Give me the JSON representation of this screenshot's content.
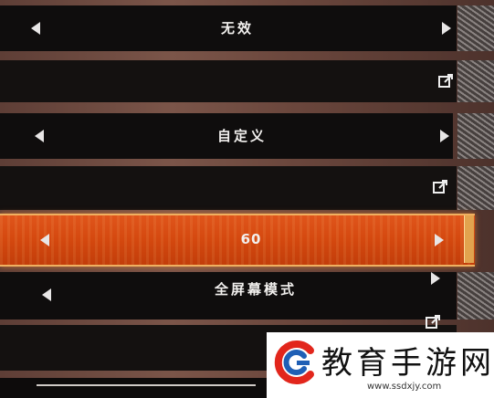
{
  "settings": {
    "rows": [
      {
        "value": "无效",
        "type": "selector"
      },
      {
        "type": "link"
      },
      {
        "value": "自定义",
        "type": "selector"
      },
      {
        "type": "link"
      },
      {
        "value": "60",
        "type": "selector",
        "active": true
      },
      {
        "value": "全屏幕模式",
        "type": "selector"
      },
      {
        "type": "link"
      }
    ]
  },
  "watermark": {
    "title": "教育手游网",
    "url": "www.ssdxjy.com"
  },
  "colors": {
    "row_bg": "#0f0d0d",
    "highlight": "#d4480f",
    "highlight_border": "#f0b060",
    "text": "#f2f0ee"
  }
}
